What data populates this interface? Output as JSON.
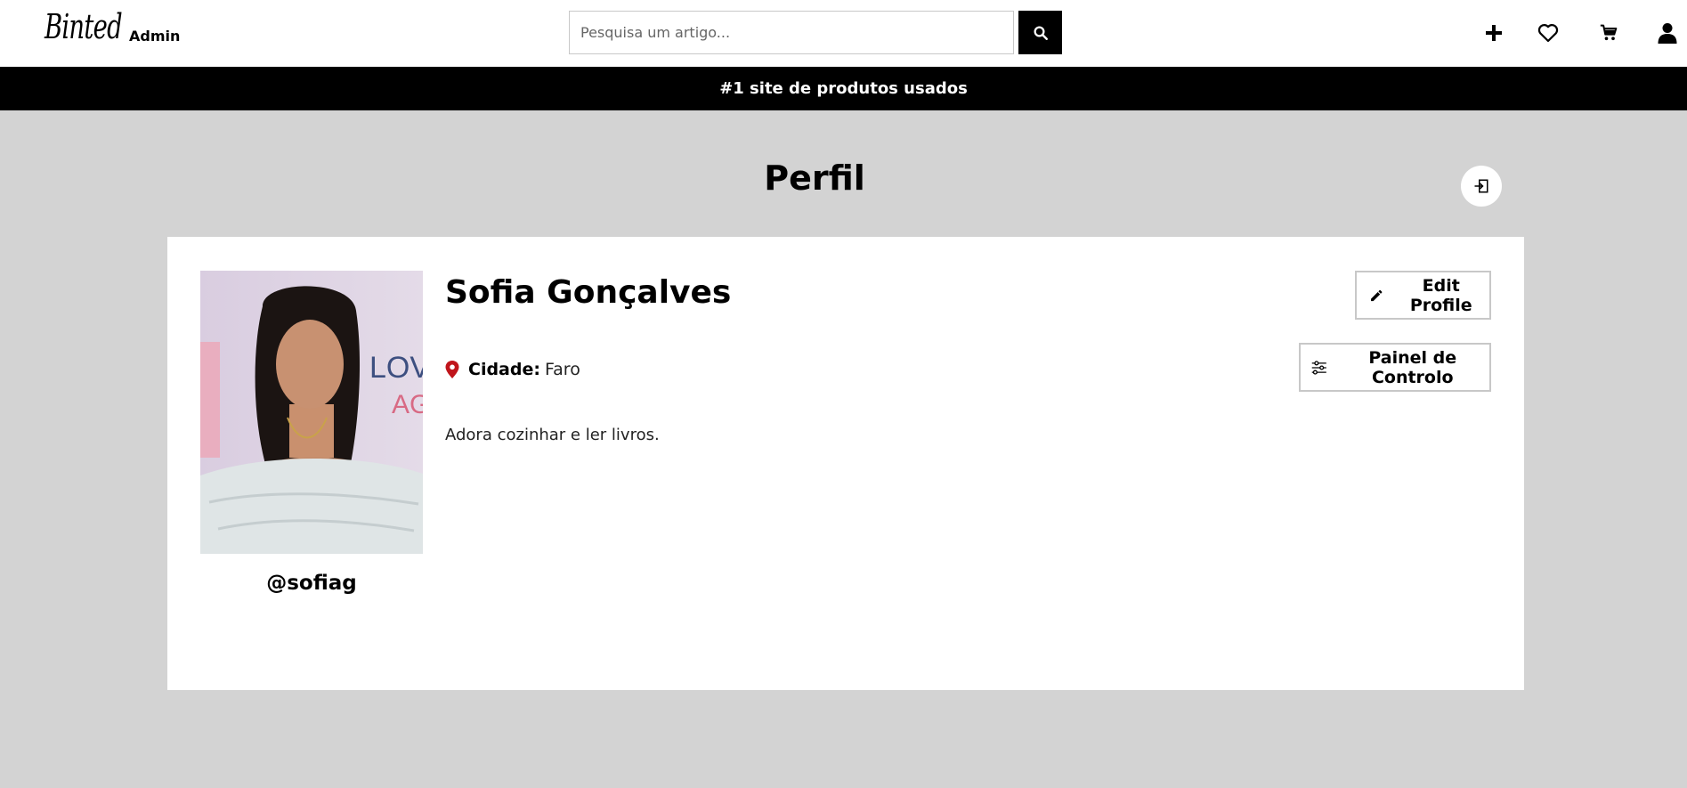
{
  "header": {
    "logo": "Binted",
    "role_label": "Admin",
    "search_placeholder": "Pesquisa um artigo...",
    "icons": [
      "search-icon",
      "plus-icon",
      "heart-icon",
      "cart-icon",
      "user-icon"
    ]
  },
  "banner": {
    "text": "#1 site de produtos usados"
  },
  "page": {
    "title": "Perfil",
    "logout_icon": "logout-icon"
  },
  "profile": {
    "name": "Sofia Gonçalves",
    "username": "@sofiag",
    "city_label": "Cidade:",
    "city_value": "Faro",
    "bio": "Adora cozinhar e ler livros.",
    "edit_label": "Edit Profile",
    "panel_label": "Painel de Controlo"
  },
  "colors": {
    "background": "#d3d3d3",
    "banner": "#000000",
    "card": "#ffffff",
    "pin": "#c0151b"
  }
}
